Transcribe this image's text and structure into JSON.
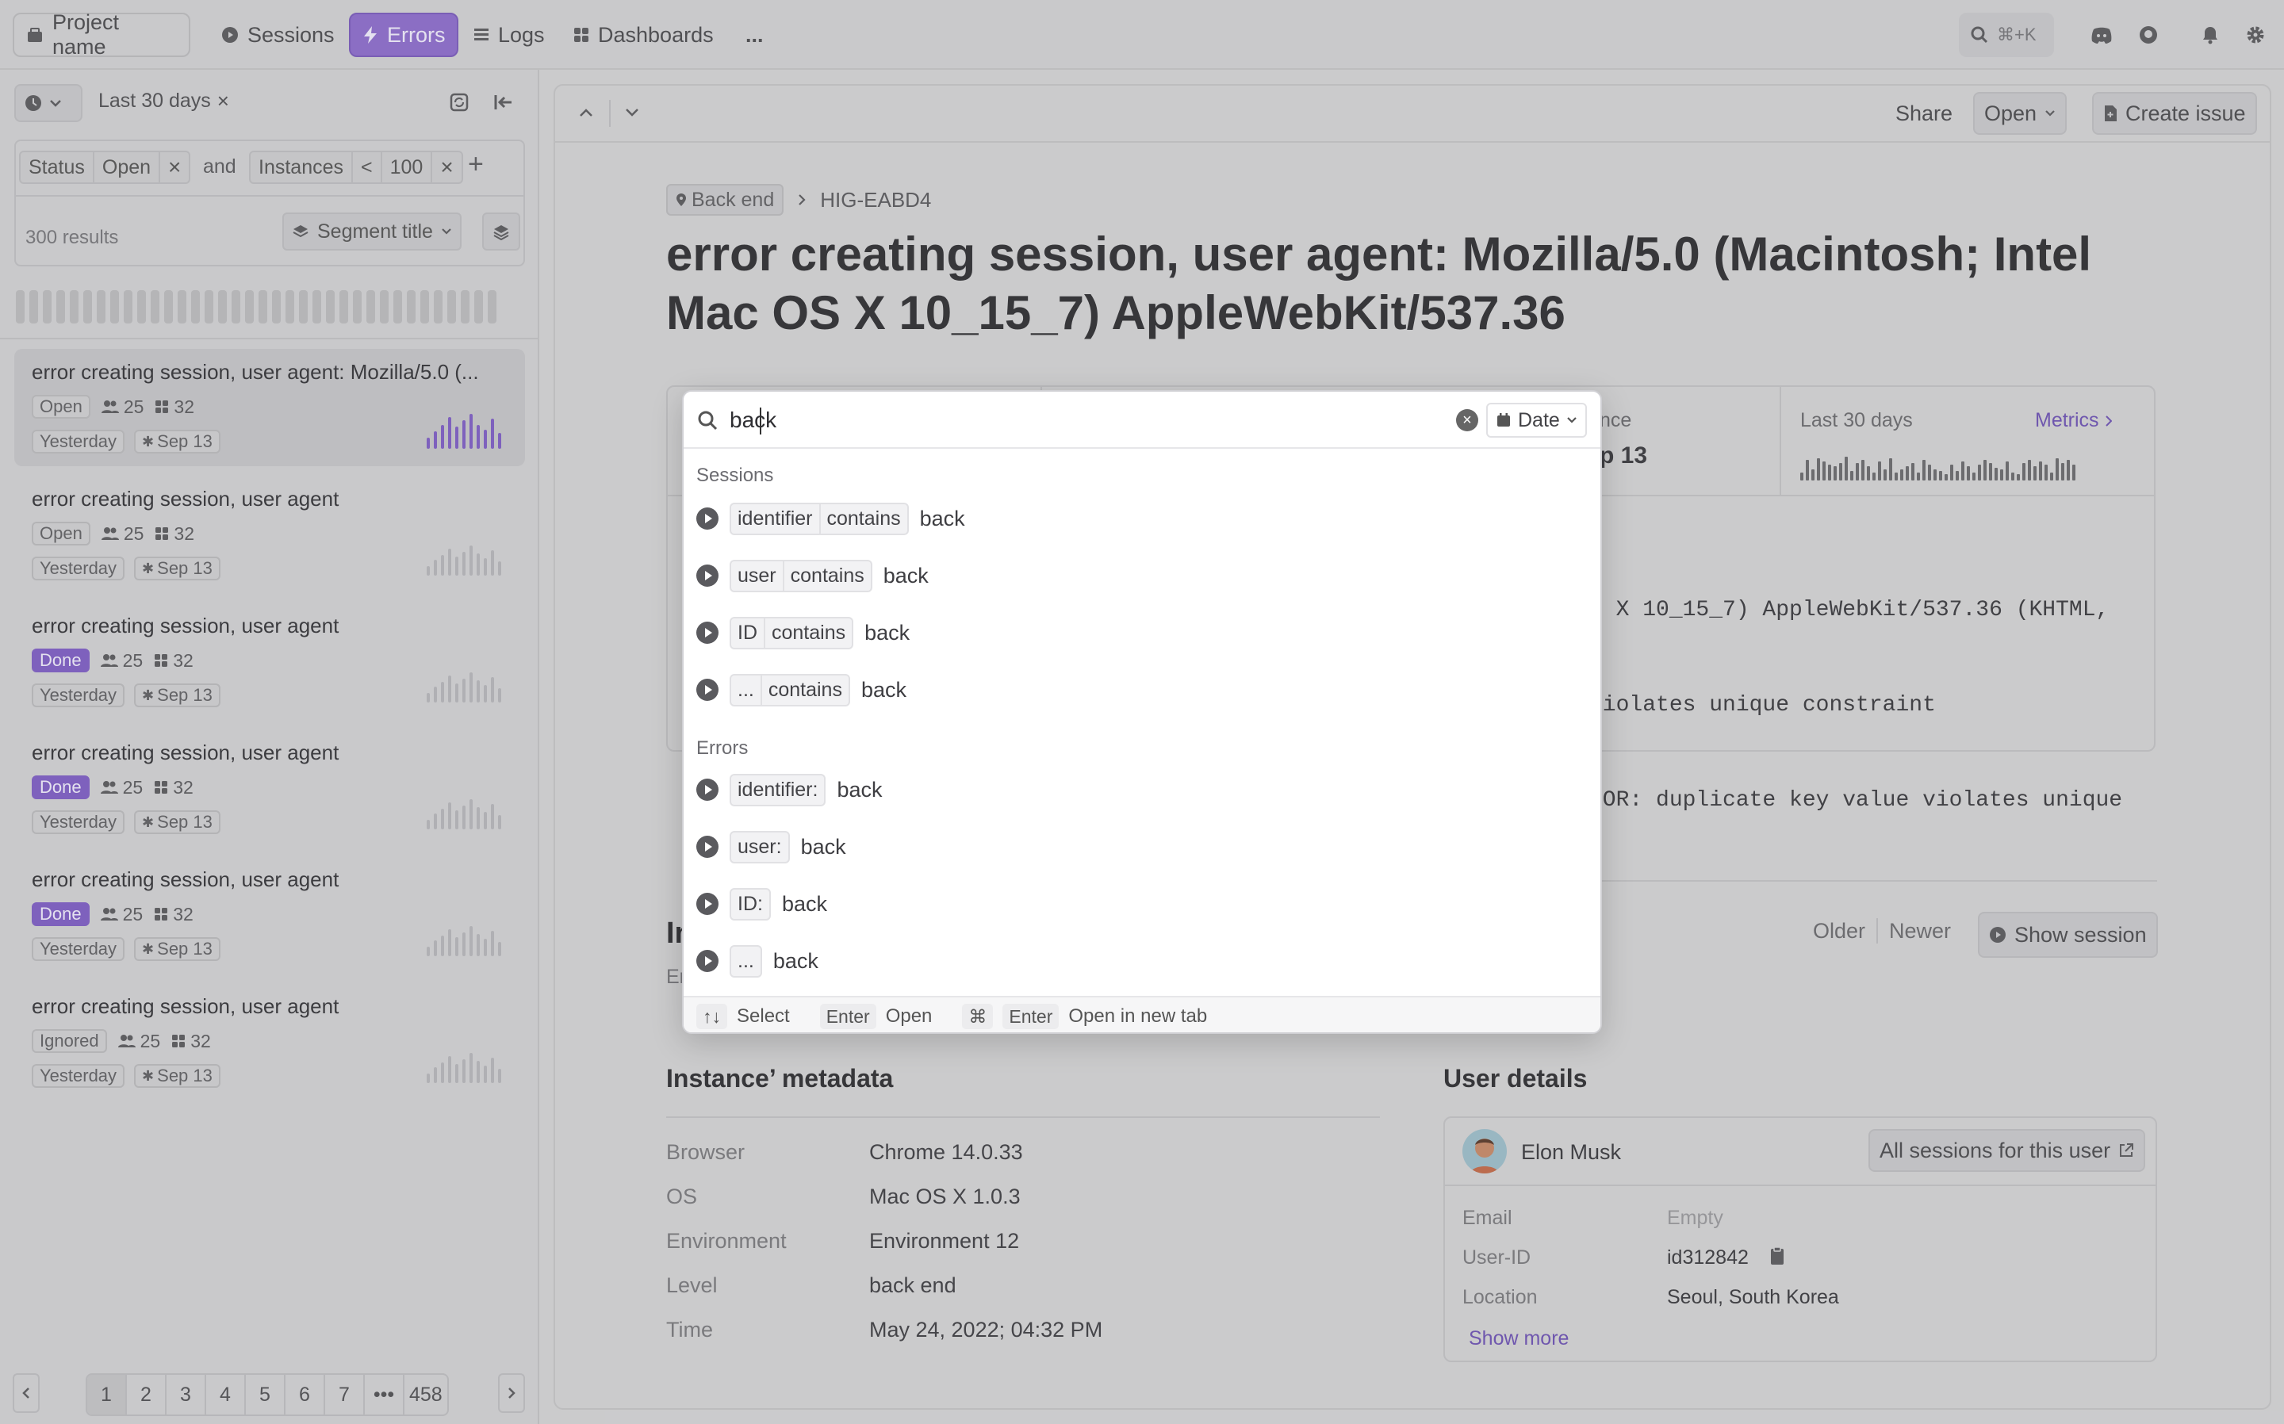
{
  "nav": {
    "project": "Project name",
    "items": [
      {
        "label": "Sessions",
        "icon": "play-circle-icon"
      },
      {
        "label": "Errors",
        "icon": "bolt-icon",
        "active": true
      },
      {
        "label": "Logs",
        "icon": "list-icon"
      },
      {
        "label": "Dashboards",
        "icon": "grid-icon"
      }
    ],
    "more": "...",
    "search_shortcut": "⌘+K"
  },
  "sidebar": {
    "date_filter": "Last 30 days",
    "filters": {
      "status_key": "Status",
      "status_val": "Open",
      "and": "and",
      "inst_key": "Instances",
      "inst_op": "<",
      "inst_val": "100"
    },
    "results": "300 results",
    "segment": "Segment title",
    "errors": [
      {
        "title": "error creating session, user agent: Mozilla/5.0 (...",
        "status": "Open",
        "users": "25",
        "instances": "32",
        "first": "Yesterday",
        "last": "Sep 13",
        "selected": true
      },
      {
        "title": "error creating session, user agent",
        "status": "Open",
        "users": "25",
        "instances": "32",
        "first": "Yesterday",
        "last": "Sep 13"
      },
      {
        "title": "error creating session, user agent",
        "status": "Done",
        "users": "25",
        "instances": "32",
        "first": "Yesterday",
        "last": "Sep 13"
      },
      {
        "title": "error creating session, user agent",
        "status": "Done",
        "users": "25",
        "instances": "32",
        "first": "Yesterday",
        "last": "Sep 13"
      },
      {
        "title": "error creating session, user agent",
        "status": "Done",
        "users": "25",
        "instances": "32",
        "first": "Yesterday",
        "last": "Sep 13"
      },
      {
        "title": "error creating session, user agent",
        "status": "Ignored",
        "users": "25",
        "instances": "32",
        "first": "Yesterday",
        "last": "Sep 13"
      }
    ],
    "pagination": {
      "pages": [
        "1",
        "2",
        "3",
        "4",
        "5",
        "6",
        "7"
      ],
      "ellipsis": "•••",
      "last": "458"
    }
  },
  "main": {
    "share": "Share",
    "status_select": "Open",
    "create_issue": "Create issue",
    "breadcrumb_tag": "Back end",
    "breadcrumb_id": "HIG-EABD4",
    "title": "error creating session, user agent: Mozilla/5.0 (Macintosh; Intel Mac OS X 10_15_7) AppleWebKit/537.36",
    "stat_partial_label": "nce",
    "stat_partial_value": "p 13",
    "metrics_range": "Last 30 days",
    "metrics_link": "Metrics",
    "stack_lines": [
      "S X 10_15_7) AppleWebKit/537.36 (KHTML,",
      "riolates unique constraint",
      "ROR: duplicate key value violates unique"
    ],
    "instance_heading_partial": "In",
    "instance_sub_partial": "Er",
    "older": "Older",
    "newer": "Newer",
    "show_session": "Show session",
    "metadata_title": "Instance’ metadata",
    "metadata": [
      {
        "label": "Browser",
        "value": "Chrome 14.0.33"
      },
      {
        "label": "OS",
        "value": "Mac OS X 1.0.3"
      },
      {
        "label": "Environment",
        "value": "Environment 12"
      },
      {
        "label": "Level",
        "value": "back end"
      },
      {
        "label": "Time",
        "value": "May 24, 2022; 04:32 PM"
      }
    ],
    "user_title": "User details",
    "user_name": "Elon Musk",
    "all_sessions": "All sessions for this user",
    "user_fields": [
      {
        "label": "Email",
        "value": "Empty"
      },
      {
        "label": "User-ID",
        "value": "id312842"
      },
      {
        "label": "Location",
        "value": "Seoul, South Korea"
      }
    ],
    "show_more": "Show more"
  },
  "search": {
    "query": "back",
    "date_button": "Date",
    "sessions_heading": "Sessions",
    "sessions": [
      {
        "parts": [
          "identifier",
          "contains"
        ],
        "value": "back"
      },
      {
        "parts": [
          "user",
          "contains"
        ],
        "value": "back"
      },
      {
        "parts": [
          "ID",
          "contains"
        ],
        "value": "back"
      },
      {
        "parts": [
          "...",
          "contains"
        ],
        "value": "back"
      }
    ],
    "errors_heading": "Errors",
    "errors": [
      {
        "parts": [
          "identifier:"
        ],
        "value": "back"
      },
      {
        "parts": [
          "user:"
        ],
        "value": "back"
      },
      {
        "parts": [
          "ID:"
        ],
        "value": "back"
      },
      {
        "parts": [
          "..."
        ],
        "value": "back"
      }
    ],
    "footer": {
      "select_key": "↑↓",
      "select": "Select",
      "enter_key": "Enter",
      "open": "Open",
      "cmd_key": "⌘",
      "cmd_enter_key": "Enter",
      "open_tab": "Open in new tab"
    }
  },
  "colors": {
    "accent": "#8e6dcf",
    "done": "#7f5ec6"
  }
}
